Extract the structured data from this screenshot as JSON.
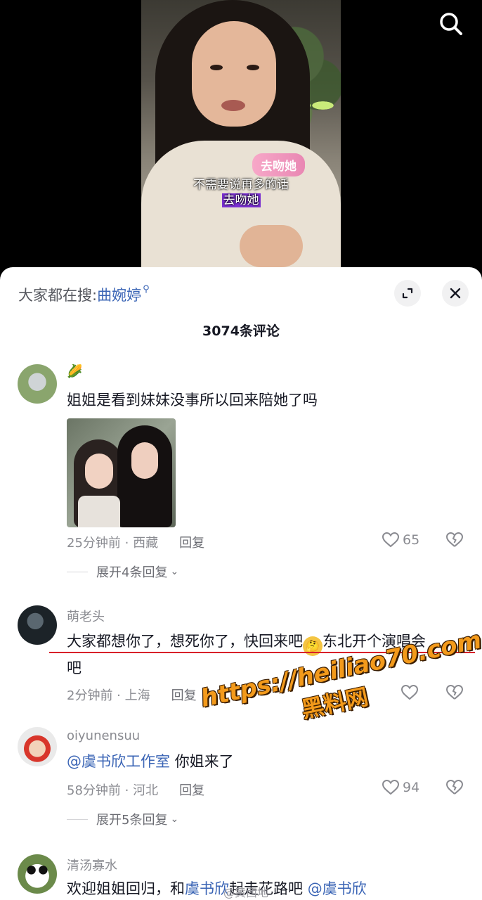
{
  "video": {
    "sticker": "去吻她",
    "subtitle_line1": "不需要说再多的话",
    "subtitle_line2": "去吻她",
    "search_icon": "search-icon"
  },
  "sheet": {
    "search_prefix": "大家都在搜:",
    "search_keyword": "曲婉婷",
    "comment_count": "3074条评论"
  },
  "comments": [
    {
      "user": "🌽",
      "text": "姐姐是看到妹妹没事所以回来陪她了吗",
      "time_location": "25分钟前 · 西藏",
      "reply_label": "回复",
      "likes": "65",
      "expand_label": "展开4条回复"
    },
    {
      "user": "萌老头",
      "text_part1": "大家都想你了，想死你了，快回来吧",
      "text_part2": "东北开个演唱会",
      "text_part3": "吧",
      "time_location": "2分钟前 · 上海",
      "reply_label": "回复"
    },
    {
      "user": "oiyunensuu",
      "mention": "@虞书欣工作室",
      "text": "你姐来了",
      "time_location": "58分钟前 · 河北",
      "reply_label": "回复",
      "likes": "94",
      "expand_label": "展开5条回复"
    },
    {
      "user": "清汤寡水",
      "text_part1": "欢迎姐姐回归，和",
      "mention1": "虞书欣",
      "text_part2": "起走花路吧",
      "mention2": "@虞书欣"
    }
  ],
  "watermark": {
    "url": "https://heiliao70.com",
    "name": "黑料网"
  },
  "source_mark": "@黄西地"
}
